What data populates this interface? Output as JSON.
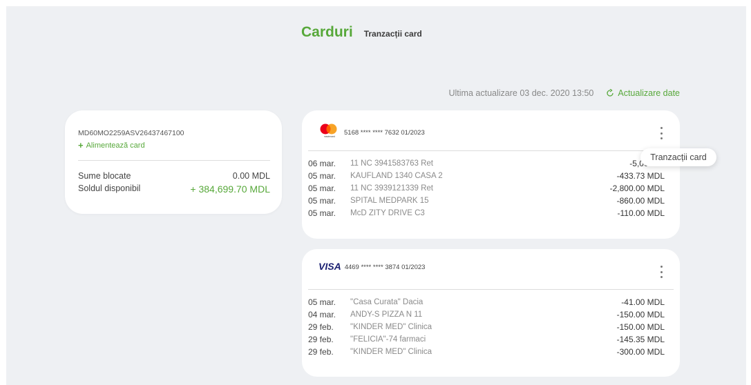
{
  "tabs": {
    "active": "Carduri",
    "inactive": "Tranzacții card"
  },
  "update": {
    "text": "Ultima actualizare 03 dec. 2020 13:50",
    "link": "Actualizare date"
  },
  "account": {
    "iban": "MD60MO2259ASV26437467100",
    "topup_label": "Alimentează card",
    "blocked_label": "Sume blocate",
    "blocked_value": "0.00 MDL",
    "available_label": "Soldul disponibil",
    "available_value": "+ 384,699.70 MDL"
  },
  "cards": [
    {
      "brand": "mastercard",
      "number": "5168 **** **** 7632  01/2023",
      "transactions": [
        {
          "date": "06 mar.",
          "desc": "11 NC 3941583763 Ret",
          "amount": "-5,000.00"
        },
        {
          "date": "05 mar.",
          "desc": "KAUFLAND 1340 CASA 2",
          "amount": "-433.73 MDL"
        },
        {
          "date": "05 mar.",
          "desc": "11 NC 3939121339 Ret",
          "amount": "-2,800.00 MDL"
        },
        {
          "date": "05 mar.",
          "desc": "SPITAL MEDPARK 15",
          "amount": "-860.00 MDL"
        },
        {
          "date": "05 mar.",
          "desc": "McD ZITY DRIVE C3",
          "amount": "-110.00 MDL"
        }
      ]
    },
    {
      "brand": "VISA",
      "number": "4469 **** **** 3874  01/2023",
      "transactions": [
        {
          "date": "05 mar.",
          "desc": "\"Casa Curata\" Dacia",
          "amount": "-41.00 MDL"
        },
        {
          "date": "04 mar.",
          "desc": "ANDY-S PIZZA N 11",
          "amount": "-150.00 MDL"
        },
        {
          "date": "29 feb.",
          "desc": "\"KINDER MED\" Clinica",
          "amount": "-150.00 MDL"
        },
        {
          "date": "29 feb.",
          "desc": "\"FELICIA\"-74 farmaci",
          "amount": "-145.35 MDL"
        },
        {
          "date": "29 feb.",
          "desc": "\"KINDER MED\" Clinica",
          "amount": "-300.00 MDL"
        }
      ]
    }
  ],
  "tooltip": "Tranzacții card",
  "colors": {
    "accent": "#57a83a",
    "background": "#eef0f3",
    "mastercard_red": "#eb001b",
    "mastercard_orange": "#f79e1b",
    "visa_blue": "#1a1f71"
  }
}
